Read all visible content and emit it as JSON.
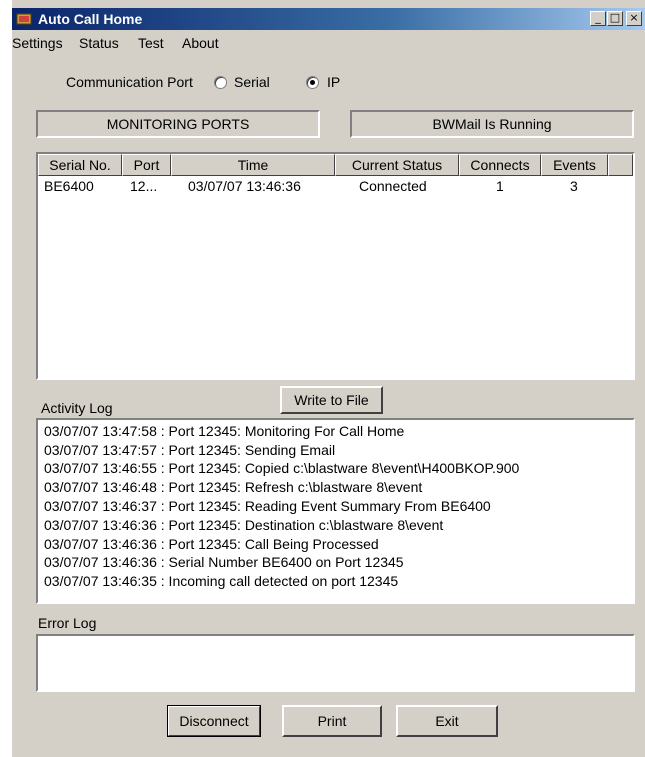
{
  "window": {
    "title": "Auto Call Home",
    "minimize_glyph": "_",
    "maximize_glyph": "□",
    "close_glyph": "×"
  },
  "menu": [
    "Settings",
    "Status",
    "Test",
    "About"
  ],
  "communication": {
    "label": "Communication Port",
    "options": [
      {
        "label": "Serial",
        "selected": false
      },
      {
        "label": "IP",
        "selected": true
      }
    ]
  },
  "panels": {
    "monitoring": "MONITORING PORTS",
    "bwmail": "BWMail Is Running"
  },
  "ports_table": {
    "columns": [
      "Serial No.",
      "Port",
      "Time",
      "Current Status",
      "Connects",
      "Events"
    ],
    "rows": [
      [
        "BE6400",
        "12...",
        "03/07/07 13:46:36",
        "Connected",
        "1",
        "3"
      ]
    ]
  },
  "buttons": {
    "write_to_file": "Write to File",
    "disconnect": "Disconnect",
    "print": "Print",
    "exit": "Exit"
  },
  "activity_log": {
    "label": "Activity Log",
    "lines": [
      "03/07/07 13:47:58 : Port 12345: Monitoring For Call Home",
      "03/07/07 13:47:57 : Port 12345: Sending Email",
      "03/07/07 13:46:55 : Port 12345: Copied c:\\blastware 8\\event\\H400BKOP.900",
      "03/07/07 13:46:48 : Port 12345: Refresh c:\\blastware 8\\event",
      "03/07/07 13:46:37 : Port 12345: Reading Event Summary From BE6400",
      "03/07/07 13:46:36 : Port 12345: Destination c:\\blastware 8\\event",
      "03/07/07 13:46:36 : Port 12345: Call Being Processed",
      "03/07/07 13:46:36 : Serial Number BE6400 on Port 12345",
      "03/07/07 13:46:35 : Incoming call detected on port 12345"
    ]
  },
  "error_log": {
    "label": "Error Log",
    "lines": []
  },
  "colors": {
    "titlebar_start": "#0a246a",
    "titlebar_end": "#a6caf0",
    "face": "#d4d0c8"
  }
}
